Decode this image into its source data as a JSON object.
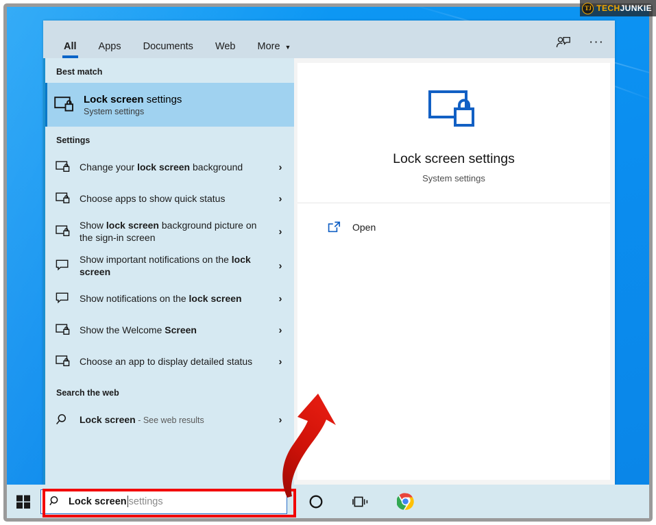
{
  "watermark": {
    "badge": "TJ",
    "tech": "TECH",
    "junkie": "JUNKIE"
  },
  "tabs": [
    {
      "label": "All",
      "active": true
    },
    {
      "label": "Apps",
      "active": false
    },
    {
      "label": "Documents",
      "active": false
    },
    {
      "label": "Web",
      "active": false
    },
    {
      "label": "More",
      "active": false,
      "caret": "▼"
    }
  ],
  "tabbar": {
    "feedback_icon": "person-feedback-icon",
    "more_options": "···"
  },
  "results": {
    "best_match_heading": "Best match",
    "best_match": {
      "title_bold": "Lock screen",
      "title_rest": " settings",
      "subtitle": "System settings",
      "icon": "monitor-lock-icon"
    },
    "settings_heading": "Settings",
    "settings_items": [
      {
        "pre": "Change your ",
        "bold": "lock screen",
        "post": " background",
        "icon": "monitor-lock-icon",
        "chevron": "›"
      },
      {
        "pre": "Choose apps to show quick status",
        "bold": "",
        "post": "",
        "icon": "monitor-lock-icon",
        "chevron": "›"
      },
      {
        "pre": "Show ",
        "bold": "lock screen",
        "post": " background picture on the sign-in screen",
        "icon": "monitor-lock-icon",
        "chevron": "›"
      },
      {
        "pre": "Show important notifications on the ",
        "bold": "lock screen",
        "post": "",
        "icon": "notification-bubble-icon",
        "chevron": "›"
      },
      {
        "pre": "Show notifications on the ",
        "bold": "lock screen",
        "post": "",
        "icon": "notification-bubble-icon",
        "chevron": "›"
      },
      {
        "pre": "Show the Welcome ",
        "bold": "Screen",
        "post": "",
        "icon": "monitor-lock-icon",
        "chevron": "›"
      },
      {
        "pre": "Choose an app to display detailed status",
        "bold": "",
        "post": "",
        "icon": "monitor-lock-icon",
        "chevron": "›"
      }
    ],
    "web_heading": "Search the web",
    "web_item": {
      "bold": "Lock screen",
      "muted": " - See web results",
      "icon": "search-icon",
      "chevron": "›"
    }
  },
  "preview": {
    "icon": "monitor-lock-icon-large",
    "title": "Lock screen settings",
    "subtitle": "System settings",
    "actions": [
      {
        "label": "Open",
        "icon": "open-external-icon"
      }
    ]
  },
  "taskbar": {
    "start_icon": "windows-start-icon",
    "search": {
      "icon": "search-icon",
      "typed_value": "Lock screen",
      "suggestion": " settings"
    },
    "icons": [
      {
        "name": "cortana-icon"
      },
      {
        "name": "task-view-icon"
      },
      {
        "name": "chrome-icon"
      }
    ]
  },
  "annotations": {
    "highlight_target": "search-box",
    "arrow": "curved-red-arrow"
  },
  "colors": {
    "accent_blue": "#0a64c8",
    "panel_blue": "#d6e9f2",
    "highlight_row": "#a0d2f0",
    "tabbar": "#cfdee8",
    "taskbar": "#d5e8f0",
    "annotation_red": "#f20000",
    "desktop_blue": "#0b8ef0"
  }
}
